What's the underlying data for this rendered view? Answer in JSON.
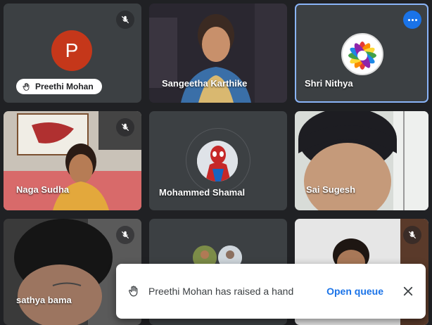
{
  "tiles": [
    {
      "name": "Preethi Mohan",
      "initial": "P"
    },
    {
      "name": "Sangeetha Karthike"
    },
    {
      "name": "Shri Nithya"
    },
    {
      "name": "Naga Sudha"
    },
    {
      "name": "Mohammed Shamal"
    },
    {
      "name": "Sai Sugesh"
    },
    {
      "name": "sathya bama"
    }
  ],
  "toast": {
    "message": "Preethi Mohan has raised a hand",
    "action": "Open queue"
  },
  "colors": {
    "accent": "#1a73e8",
    "tile_bg": "#3c4043",
    "active_border": "#8ab4f8",
    "avatar_p": "#c5371a"
  }
}
